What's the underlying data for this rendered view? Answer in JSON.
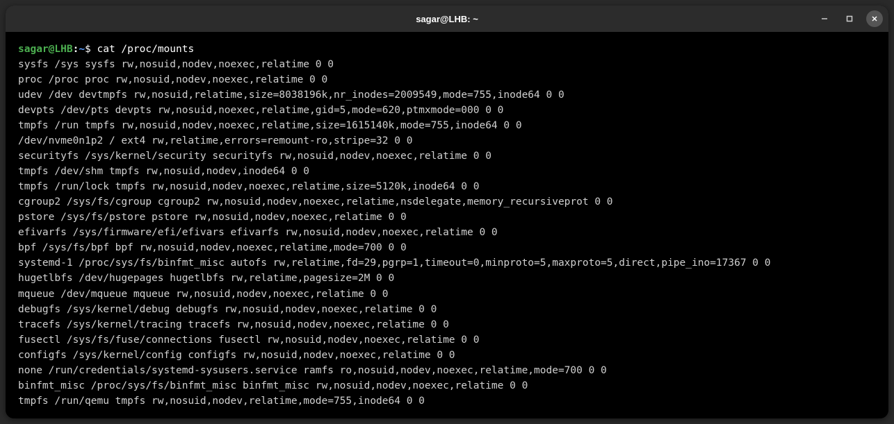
{
  "window": {
    "title": "sagar@LHB: ~"
  },
  "prompt": {
    "user_host": "sagar@LHB",
    "separator": ":",
    "path": "~",
    "symbol": "$"
  },
  "command": "cat /proc/mounts",
  "output_lines": [
    "sysfs /sys sysfs rw,nosuid,nodev,noexec,relatime 0 0",
    "proc /proc proc rw,nosuid,nodev,noexec,relatime 0 0",
    "udev /dev devtmpfs rw,nosuid,relatime,size=8038196k,nr_inodes=2009549,mode=755,inode64 0 0",
    "devpts /dev/pts devpts rw,nosuid,noexec,relatime,gid=5,mode=620,ptmxmode=000 0 0",
    "tmpfs /run tmpfs rw,nosuid,nodev,noexec,relatime,size=1615140k,mode=755,inode64 0 0",
    "/dev/nvme0n1p2 / ext4 rw,relatime,errors=remount-ro,stripe=32 0 0",
    "securityfs /sys/kernel/security securityfs rw,nosuid,nodev,noexec,relatime 0 0",
    "tmpfs /dev/shm tmpfs rw,nosuid,nodev,inode64 0 0",
    "tmpfs /run/lock tmpfs rw,nosuid,nodev,noexec,relatime,size=5120k,inode64 0 0",
    "cgroup2 /sys/fs/cgroup cgroup2 rw,nosuid,nodev,noexec,relatime,nsdelegate,memory_recursiveprot 0 0",
    "pstore /sys/fs/pstore pstore rw,nosuid,nodev,noexec,relatime 0 0",
    "efivarfs /sys/firmware/efi/efivars efivarfs rw,nosuid,nodev,noexec,relatime 0 0",
    "bpf /sys/fs/bpf bpf rw,nosuid,nodev,noexec,relatime,mode=700 0 0",
    "systemd-1 /proc/sys/fs/binfmt_misc autofs rw,relatime,fd=29,pgrp=1,timeout=0,minproto=5,maxproto=5,direct,pipe_ino=17367 0 0",
    "hugetlbfs /dev/hugepages hugetlbfs rw,relatime,pagesize=2M 0 0",
    "mqueue /dev/mqueue mqueue rw,nosuid,nodev,noexec,relatime 0 0",
    "debugfs /sys/kernel/debug debugfs rw,nosuid,nodev,noexec,relatime 0 0",
    "tracefs /sys/kernel/tracing tracefs rw,nosuid,nodev,noexec,relatime 0 0",
    "fusectl /sys/fs/fuse/connections fusectl rw,nosuid,nodev,noexec,relatime 0 0",
    "configfs /sys/kernel/config configfs rw,nosuid,nodev,noexec,relatime 0 0",
    "none /run/credentials/systemd-sysusers.service ramfs ro,nosuid,nodev,noexec,relatime,mode=700 0 0",
    "binfmt_misc /proc/sys/fs/binfmt_misc binfmt_misc rw,nosuid,nodev,noexec,relatime 0 0",
    "tmpfs /run/qemu tmpfs rw,nosuid,nodev,relatime,mode=755,inode64 0 0"
  ]
}
